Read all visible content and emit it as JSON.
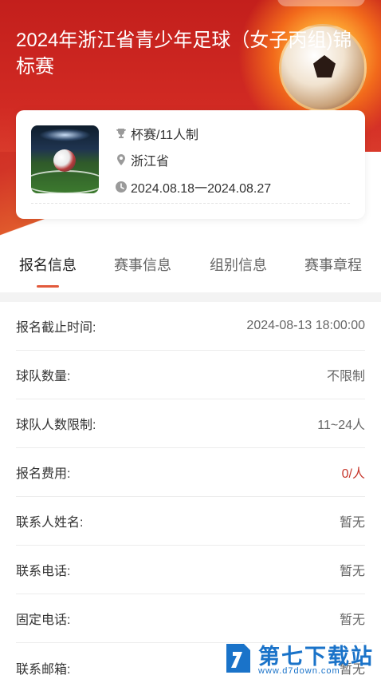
{
  "event": {
    "title": "2024年浙江省青少年足球（女子丙组)锦标赛",
    "type": "杯赛/11人制",
    "location": "浙江省",
    "dates": "2024.08.18一2024.08.27"
  },
  "tabs": [
    {
      "label": "报名信息",
      "active": true
    },
    {
      "label": "赛事信息",
      "active": false
    },
    {
      "label": "组别信息",
      "active": false
    },
    {
      "label": "赛事章程",
      "active": false
    }
  ],
  "rows": [
    {
      "label": "报名截止时间:",
      "value": "2024-08-13 18:00:00"
    },
    {
      "label": "球队数量:",
      "value": "不限制"
    },
    {
      "label": "球队人数限制:",
      "value": "11~24人"
    },
    {
      "label": "报名费用:",
      "value": "0/人"
    },
    {
      "label": "联系人姓名:",
      "value": "暂无"
    },
    {
      "label": "联系电话:",
      "value": "暂无"
    },
    {
      "label": "固定电话:",
      "value": "暂无"
    },
    {
      "label": "联系邮箱:",
      "value": "暂无"
    }
  ],
  "watermark": {
    "name": "第七下载站",
    "url": "www.d7down.com"
  },
  "colors": {
    "brand_red": "#c8201d",
    "fee_red": "#c7372c",
    "tab_indicator": "#e25a3c",
    "watermark_blue": "#1a73c9"
  },
  "icons": {
    "type": "trophy-icon",
    "location": "location-pin-icon",
    "dates": "clock-icon"
  }
}
